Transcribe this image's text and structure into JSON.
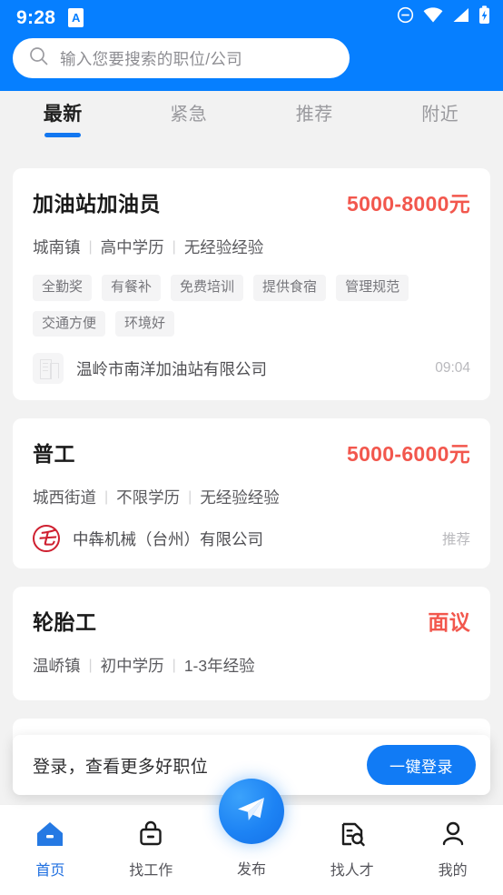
{
  "statusbar": {
    "time": "9:28",
    "app_badge": "A",
    "icons": [
      "do-not-disturb-icon",
      "wifi-icon",
      "signal-icon",
      "battery-charging-icon"
    ]
  },
  "colors": {
    "header_blue": "#067FFF",
    "accent_blue": "#1277F0",
    "salary_red": "#F2574D",
    "page_bg": "#F2F2F2"
  },
  "search": {
    "placeholder": "输入您要搜索的职位/公司",
    "icon": "search-icon"
  },
  "tabs": [
    {
      "label": "最新",
      "active": true
    },
    {
      "label": "紧急",
      "active": false
    },
    {
      "label": "推荐",
      "active": false
    },
    {
      "label": "附近",
      "active": false
    }
  ],
  "jobs": [
    {
      "title": "加油站加油员",
      "salary": "5000-8000元",
      "meta": [
        "城南镇",
        "高中学历",
        "无经验经验"
      ],
      "tags": [
        "全勤奖",
        "有餐补",
        "免费培训",
        "提供食宿",
        "管理规范",
        "交通方便",
        "环境好"
      ],
      "company": "温岭市南洋加油站有限公司",
      "logo_type": "placeholder-building-icon",
      "logo_text": "",
      "extra": "09:04"
    },
    {
      "title": "普工",
      "salary": "5000-6000元",
      "meta": [
        "城西街道",
        "不限学历",
        "无经验经验"
      ],
      "tags": [],
      "company": "中犇机械（台州）有限公司",
      "logo_type": "company-logo-red",
      "logo_text": "乇",
      "extra": "推荐"
    },
    {
      "title": "轮胎工",
      "salary": "面议",
      "meta": [
        "温峤镇",
        "初中学历",
        "1-3年经验"
      ],
      "tags": [],
      "company": "",
      "logo_type": "",
      "logo_text": "",
      "extra": ""
    }
  ],
  "login_bar": {
    "text": "登录，查看更多好职位",
    "button_label": "一键登录"
  },
  "bottom_nav": {
    "items": [
      {
        "label": "首页",
        "icon": "home-icon",
        "active": true
      },
      {
        "label": "找工作",
        "icon": "briefcase-icon",
        "active": false
      },
      {
        "label": "找人才",
        "icon": "resume-search-icon",
        "active": false
      },
      {
        "label": "我的",
        "icon": "person-icon",
        "active": false
      }
    ],
    "fab": {
      "label": "发布",
      "icon": "send-plane-icon"
    }
  }
}
